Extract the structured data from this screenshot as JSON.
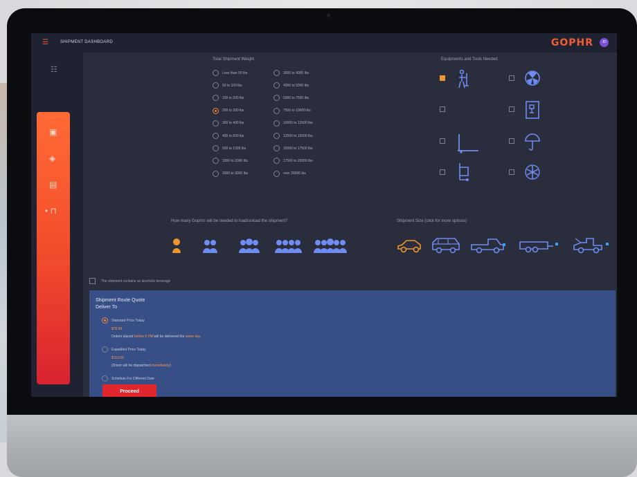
{
  "header": {
    "menu_icon": "menu-icon",
    "title": "SHIPMENT DASHBOARD",
    "logo": "GOPHR",
    "avatar_initials": "JD"
  },
  "sidebar": {
    "items": [
      {
        "icon": "dashboard-icon"
      },
      {
        "icon": "briefcase-icon"
      },
      {
        "icon": "tag-icon"
      },
      {
        "icon": "clipboard-icon"
      },
      {
        "icon": "cart-icon"
      }
    ]
  },
  "weight": {
    "label": "Total Shipment Weight",
    "left_options": [
      "Less than 50 lbs",
      "50 to 100 lbs",
      "100 to 200 lbs",
      "200 to 300 lbs",
      "300 to 400 lbs",
      "400 to 500 lbs",
      "500 to 1000 lbs",
      "1000 to 2000 lbs",
      "2000 to 3000 lbs"
    ],
    "right_options": [
      "3000 to 4000 lbs",
      "4000 to 5000 lbs",
      "5000 to 7500 lbs",
      "7500 to 10000 lbs",
      "10000 to 12500 lbs",
      "12500 to 15000 lbs",
      "15000 to 17500 lbs",
      "17500 to 20000 lbs",
      "over 20000 lbs"
    ],
    "selected": "200 to 300 lbs"
  },
  "equipment": {
    "label": "Equipments and Tools Needed",
    "items": [
      {
        "icon": "hand-truck-icon",
        "checked": true
      },
      {
        "icon": "radioactive-icon",
        "checked": false
      },
      {
        "icon": "blank-icon",
        "checked": false
      },
      {
        "icon": "fragile-box-icon",
        "checked": false
      },
      {
        "icon": "pallet-jack-icon",
        "checked": false
      },
      {
        "icon": "umbrella-icon",
        "checked": false
      },
      {
        "icon": "dolly-icon",
        "checked": false
      },
      {
        "icon": "snowflake-icon",
        "checked": false
      }
    ]
  },
  "helpers": {
    "label": "How many Gophrs will be needed to load/unload the shipment?",
    "counts": [
      1,
      2,
      3,
      4,
      5
    ],
    "selected": 1
  },
  "vehicles": {
    "label": "Shipment Size (click  for more options)",
    "items": [
      "car-icon",
      "suv-icon",
      "pickup-truck-icon",
      "trailer-icon",
      "tow-truck-icon"
    ],
    "selected": "car-icon"
  },
  "beverage": {
    "label": "The shipment contains an alcoholic beverage",
    "checked": false
  },
  "quote": {
    "title": "Shipment Route Quote",
    "deliver_to": "Deliver To",
    "options": [
      {
        "label": "Standard Price Today",
        "price": "$78.99",
        "note_pre": "Orders placed ",
        "note_hl1": "before 5 PM",
        "note_mid": " will be delivered the ",
        "note_hl2": "same day",
        "note_post": ".",
        "selected": true
      },
      {
        "label": "Expedited Price Today",
        "price": "$110.00",
        "note_pre": "(Driver will be dispatched ",
        "note_hl1": "immediately",
        "note_post": ")",
        "selected": false
      },
      {
        "label": "Schedule For Different Date",
        "selected": false
      }
    ],
    "proceed": "Proceed"
  },
  "colors": {
    "accent": "#ef5d34",
    "orange": "#f0962e",
    "helper_blue": "#6f8cf3",
    "panel": "#384e86",
    "bg": "#2a2d3b"
  }
}
